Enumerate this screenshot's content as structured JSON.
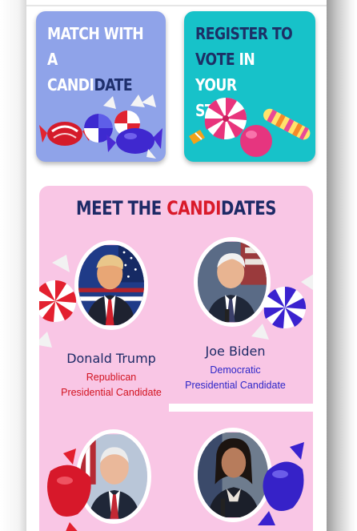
{
  "cards": {
    "match": {
      "line1": "MATCH WITH A",
      "line2_light": "CANDI",
      "line2_dark": "DATE"
    },
    "register": {
      "line1": "REGISTER TO",
      "line2_dark": "VOTE",
      "line2_light": " IN YOUR",
      "line3": "STATE"
    }
  },
  "meet": {
    "title_a": "MEET THE ",
    "title_red": "CANDI",
    "title_b": "DATES"
  },
  "candidates": [
    {
      "name": "Donald Trump",
      "party": "Republican",
      "role": "Presidential Candidate"
    },
    {
      "name": "Joe Biden",
      "party": "Democratic",
      "role": "Presidential Candidate"
    },
    {
      "name": "",
      "party": "",
      "role": ""
    },
    {
      "name": "",
      "party": "",
      "role": ""
    }
  ],
  "colors": {
    "match_card": "#8fa3e9",
    "register_card": "#17c2c9",
    "section_bg": "#f9c6e5",
    "navy": "#1d2a66",
    "republican": "#d2121f",
    "democratic": "#2d26c8"
  },
  "icons": [
    "candy-cluster-icon",
    "peppermint-candy-icon",
    "wrapped-candy-icon",
    "lollipop-icon"
  ]
}
